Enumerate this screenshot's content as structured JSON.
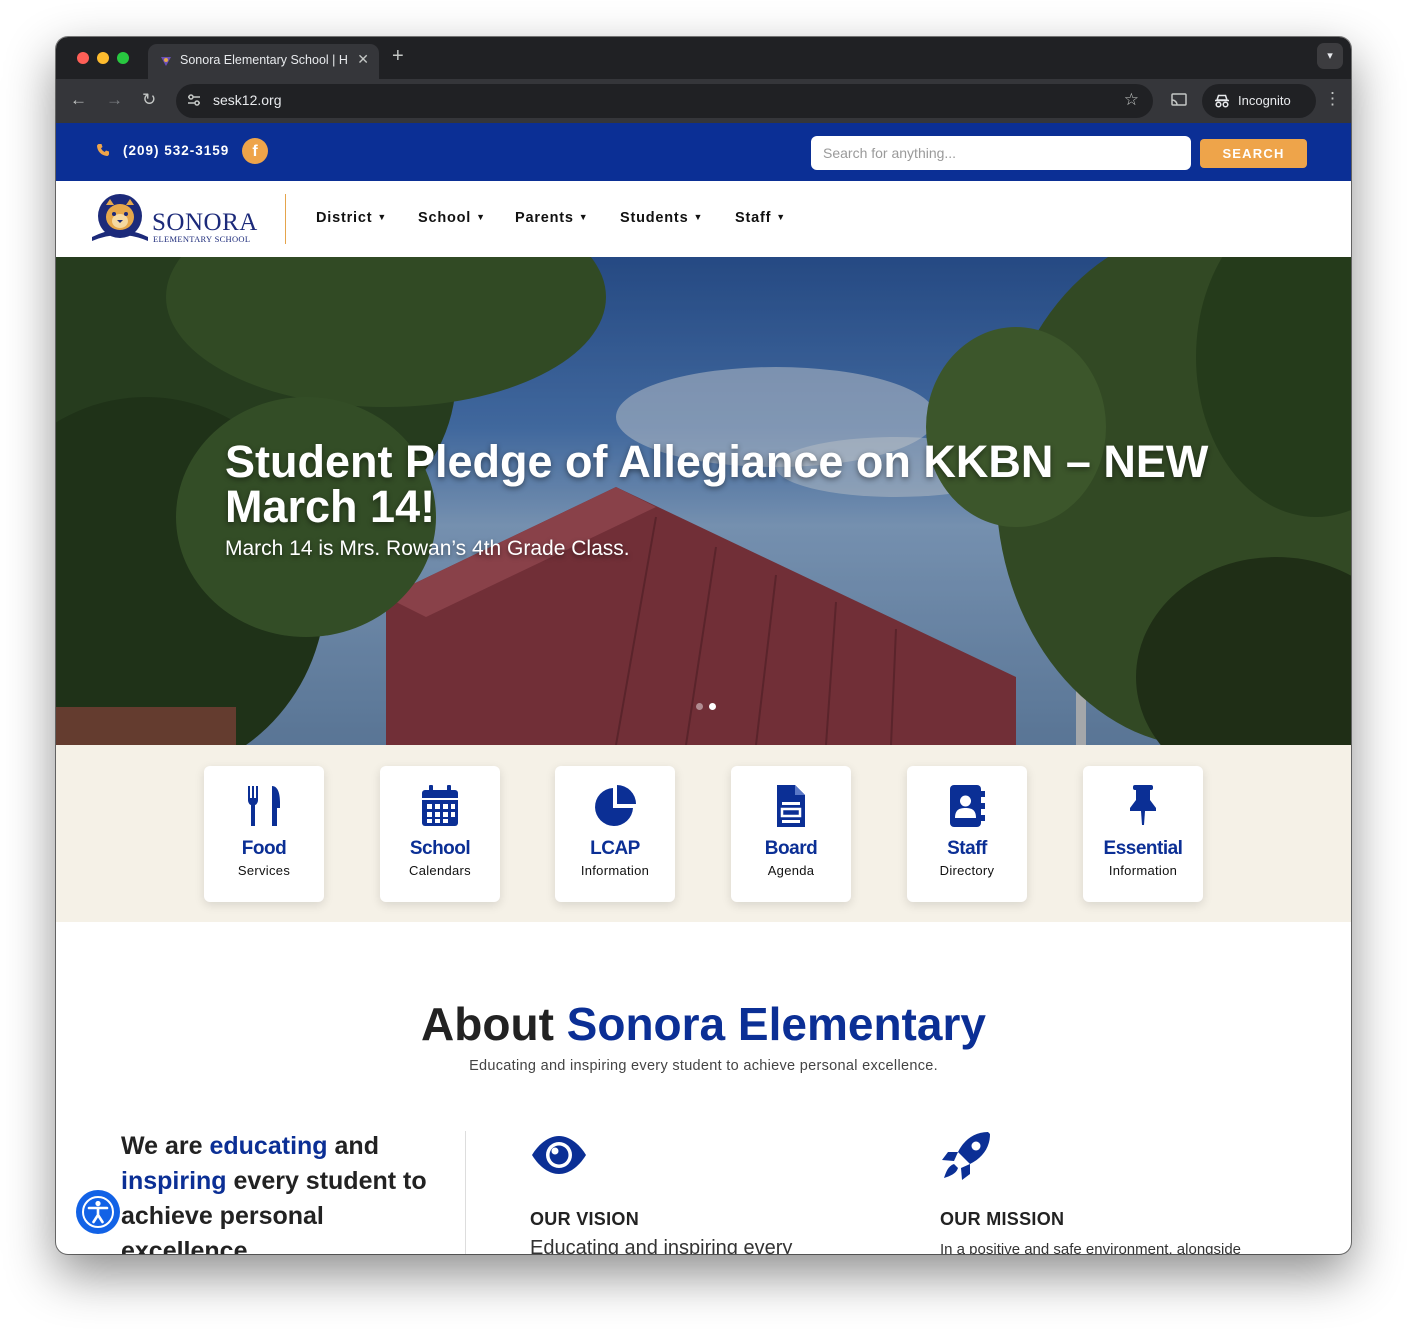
{
  "browser": {
    "tab_title": "Sonora Elementary School | H",
    "url": "sesk12.org",
    "incognito_label": "Incognito",
    "traffic_lights": [
      "#ff5f57",
      "#febc2e",
      "#28c840"
    ]
  },
  "topbar": {
    "phone": "(209) 532-3159",
    "facebook_icon": "f",
    "search_placeholder": "Search for anything...",
    "search_button": "SEARCH"
  },
  "logo": {
    "word": "SONORA",
    "sub": "ELEMENTARY SCHOOL"
  },
  "nav": {
    "items": [
      {
        "label": "District"
      },
      {
        "label": "School"
      },
      {
        "label": "Parents"
      },
      {
        "label": "Students"
      },
      {
        "label": "Staff"
      }
    ]
  },
  "hero": {
    "title": "Student Pledge of Allegiance on KKBN – NEW March 14!",
    "subtitle": "March 14 is Mrs. Rowan’s 4th Grade Class.",
    "slide_count": 2,
    "active_slide": 2
  },
  "quicklinks": [
    {
      "title": "Food",
      "sub": "Services",
      "icon": "utensils-icon"
    },
    {
      "title": "School",
      "sub": "Calendars",
      "icon": "calendar-icon"
    },
    {
      "title": "LCAP",
      "sub": "Information",
      "icon": "pie-chart-icon"
    },
    {
      "title": "Board",
      "sub": "Agenda",
      "icon": "document-icon"
    },
    {
      "title": "Staff",
      "sub": "Directory",
      "icon": "address-book-icon"
    },
    {
      "title": "Essential",
      "sub": "Information",
      "icon": "pushpin-icon"
    }
  ],
  "about": {
    "title_plain": "About",
    "title_accent": "Sonora Elementary",
    "subtitle": "Educating and inspiring every student to achieve personal excellence.",
    "tagline_1": "We are",
    "tagline_2": "educating",
    "tagline_3": "and",
    "tagline_4": "inspiring",
    "tagline_5": "every student to achieve personal excellence.",
    "vision_head": "OUR VISION",
    "vision_text": "Educating and inspiring every",
    "mission_head": "OUR MISSION",
    "mission_text": "In a positive and safe environment, alongside"
  },
  "colors": {
    "brand_blue": "#0b2f95",
    "accent_orange": "#eea44a",
    "cream": "#f5f1e7"
  }
}
